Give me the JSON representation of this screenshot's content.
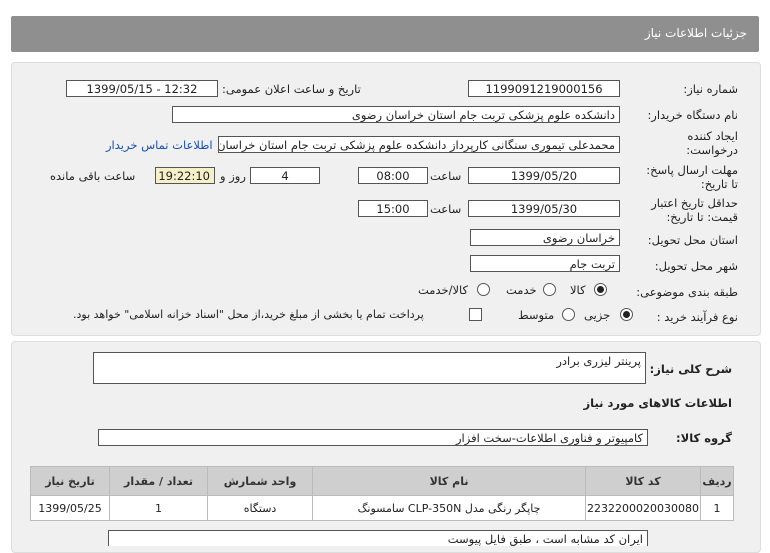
{
  "header": {
    "title": "جزئیات اطلاعات نیاز"
  },
  "fields": {
    "need_number_label": "شماره نیاز:",
    "need_number": "1199091219000156",
    "announce_label": "تاریخ و ساعت اعلان عمومی:",
    "announce_value": "1399/05/15 - 12:32",
    "buyer_org_label": "نام دستگاه خریدار:",
    "buyer_org": "دانشکده علوم پزشکی تربت جام استان خراسان رضوی",
    "creator_label_1": "ایجاد کننده",
    "creator_label_2": "درخواست:",
    "creator": "محمدعلی تیموری سنگانی کارپرداز دانشکده علوم پزشکی تربت جام استان خراسان",
    "contact_link": "اطلاعات تماس خریدار",
    "deadline_label_1": "مهلت ارسال پاسخ:",
    "deadline_label_2": "تا تاریخ:",
    "deadline_date": "1399/05/20",
    "time_label": "ساعت",
    "deadline_time": "08:00",
    "days": "4",
    "days_label": "روز و",
    "remaining_time": "19:22:10",
    "remaining_label": "ساعت باقی مانده",
    "validity_label_1": "حداقل تاریخ اعتبار",
    "validity_label_2": "قیمت: تا تاریخ:",
    "validity_date": "1399/05/30",
    "validity_time": "15:00",
    "province_label": "استان محل تحویل:",
    "province": "خراسان رضوی",
    "city_label": "شهر محل تحویل:",
    "city": "تربت جام",
    "category_label": "طبقه بندی موضوعی:",
    "cat_goods": "کالا",
    "cat_service": "خدمت",
    "cat_goods_service": "کالا/خدمت",
    "purchase_type_label": "نوع فرآیند خرید :",
    "pt_partial": "جزیی",
    "pt_medium": "متوسط",
    "pt_note": "پرداخت تمام یا بخشی از مبلغ خرید،از محل \"اسناد خزانه اسلامی\" خواهد بود."
  },
  "details": {
    "summary_label": "شرح کلی نیاز:",
    "summary": "پرینتر لیزری برادر",
    "goods_info_title": "اطلاعات کالاهای مورد نیاز",
    "group_label": "گروه کالا:",
    "group": "کامپیوتر و فناوری اطلاعات-سخت افزار",
    "note": "ایران کد مشابه است ، طبق فایل پیوست"
  },
  "table": {
    "headers": [
      "ردیف",
      "کد کالا",
      "نام کالا",
      "واحد شمارش",
      "تعداد / مقدار",
      "تاریخ نیاز"
    ],
    "rows": [
      [
        "1",
        "2232200020030080",
        "چاپگر رنگی مدل CLP-350N سامسونگ",
        "دستگاه",
        "1",
        "1399/05/25"
      ]
    ]
  }
}
